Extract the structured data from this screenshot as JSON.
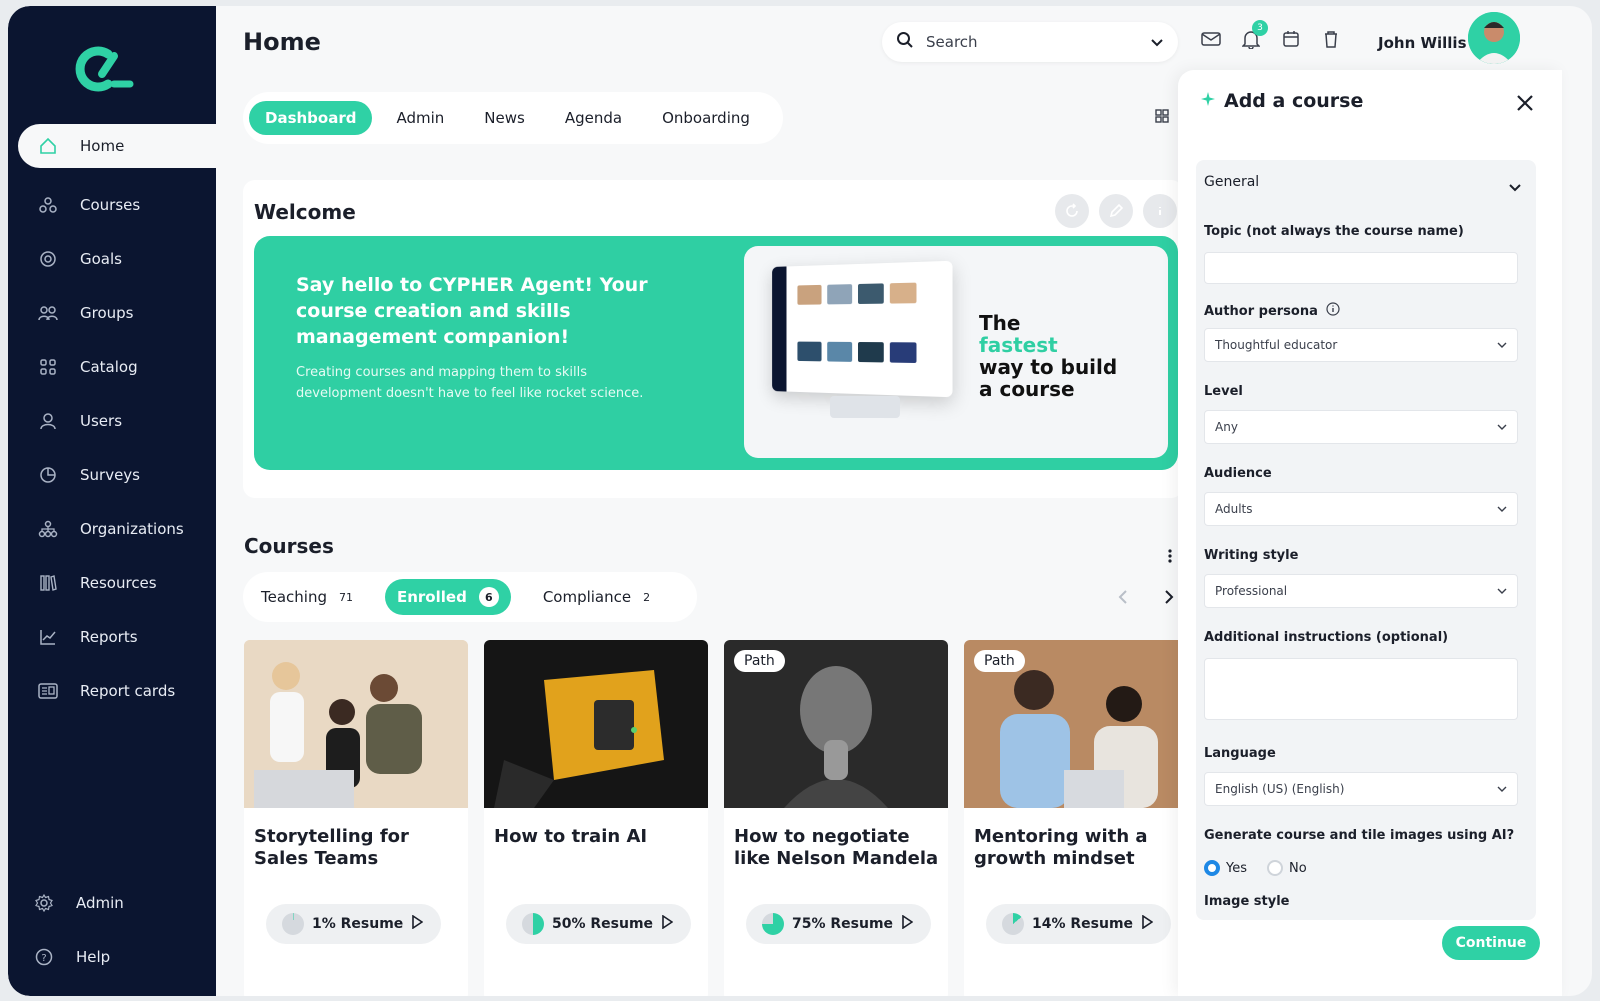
{
  "app": {
    "page_title": "Home",
    "accent_color": "#2fd1a5",
    "sidebar_color": "#0b1530"
  },
  "sidebar": {
    "logo_icon": "cypher-logo",
    "items": [
      {
        "label": "Home",
        "icon": "home-icon",
        "active": true
      },
      {
        "label": "Courses",
        "icon": "courses-icon"
      },
      {
        "label": "Goals",
        "icon": "goals-icon"
      },
      {
        "label": "Groups",
        "icon": "groups-icon"
      },
      {
        "label": "Catalog",
        "icon": "catalog-icon"
      },
      {
        "label": "Users",
        "icon": "users-icon"
      },
      {
        "label": "Surveys",
        "icon": "surveys-icon"
      },
      {
        "label": "Organizations",
        "icon": "organizations-icon"
      },
      {
        "label": "Resources",
        "icon": "resources-icon"
      },
      {
        "label": "Reports",
        "icon": "reports-icon"
      },
      {
        "label": "Report cards",
        "icon": "report-cards-icon"
      }
    ],
    "bottom": [
      {
        "label": "Admin",
        "icon": "gear-icon"
      },
      {
        "label": "Help",
        "icon": "help-icon"
      }
    ]
  },
  "header": {
    "search_placeholder": "Search",
    "notification_count": "3",
    "user_name": "John Willis"
  },
  "tabs": [
    "Dashboard",
    "Admin",
    "News",
    "Agenda",
    "Onboarding"
  ],
  "welcome": {
    "title": "Welcome",
    "banner_heading": "Say hello to CYPHER Agent! Your course creation and skills management companion!",
    "banner_text": "Creating courses and mapping them to skills development doesn't have to feel like rocket science.",
    "tagline_1": "The",
    "tagline_accent": "fastest",
    "tagline_2": "way to build",
    "tagline_3": "a course"
  },
  "courses": {
    "title": "Courses",
    "tabs": [
      {
        "label": "Teaching",
        "count": "71"
      },
      {
        "label": "Enrolled",
        "count": "6",
        "active": true
      },
      {
        "label": "Compliance",
        "count": "2"
      }
    ],
    "cards": [
      {
        "title": "Storytelling for Sales Teams",
        "progress": 1,
        "resume": "1% Resume",
        "path": ""
      },
      {
        "title": "How to train AI",
        "progress": 50,
        "resume": "50% Resume",
        "path": ""
      },
      {
        "title": "How to negotiate like Nelson Mandela",
        "progress": 75,
        "resume": "75% Resume",
        "path": "Path"
      },
      {
        "title": "Mentoring with a growth mindset",
        "progress": 14,
        "resume": "14% Resume",
        "path": "Path"
      }
    ]
  },
  "panel": {
    "title": "Add a course",
    "section": "General",
    "topic_label": "Topic (not always the course name)",
    "topic_value": "",
    "persona_label": "Author persona",
    "persona_value": "Thoughtful educator",
    "level_label": "Level",
    "level_value": "Any",
    "audience_label": "Audience",
    "audience_value": "Adults",
    "writing_label": "Writing style",
    "writing_value": "Professional",
    "instructions_label": "Additional instructions (optional)",
    "language_label": "Language",
    "language_value": "English (US) (English)",
    "images_label": "Generate course and tile images using AI?",
    "yes_label": "Yes",
    "no_label": "No",
    "image_style_label": "Image style",
    "continue_label": "Continue"
  }
}
